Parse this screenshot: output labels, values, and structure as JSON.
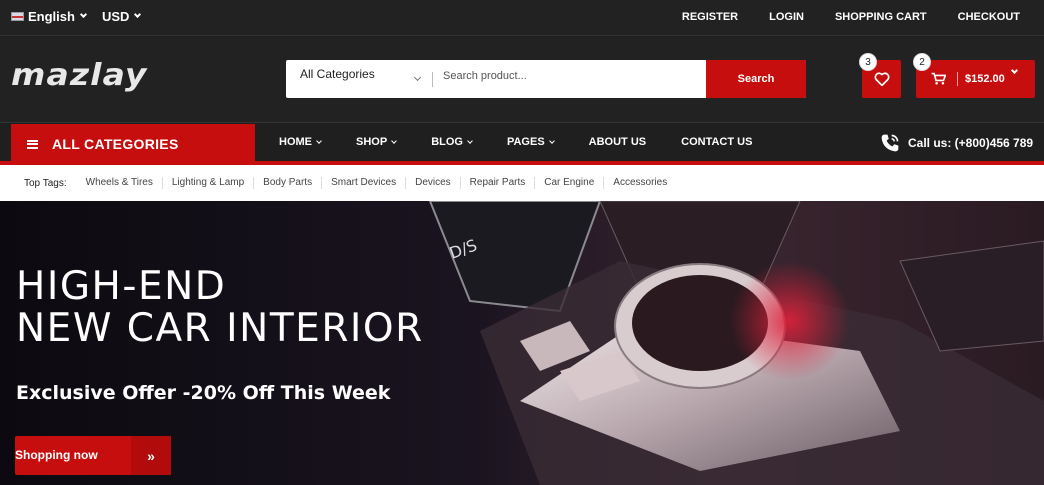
{
  "topbar": {
    "language": "English",
    "currency": "USD",
    "links": [
      "REGISTER",
      "LOGIN",
      "SHOPPING CART",
      "CHECKOUT"
    ]
  },
  "header": {
    "logo": "mazlay",
    "search_category": "All Categories",
    "search_placeholder": "Search product...",
    "search_button": "Search",
    "wishlist_count": "3",
    "cart_count": "2",
    "cart_total": "$152.00"
  },
  "nav": {
    "all_categories": "ALL CATEGORIES",
    "items": [
      "HOME",
      "SHOP",
      "BLOG",
      "PAGES",
      "ABOUT US",
      "CONTACT US"
    ],
    "call": "Call us: (+800)456 789"
  },
  "tags": {
    "label": "Top Tags:",
    "items": [
      "Wheels & Tires",
      "Lighting & Lamp",
      "Body Parts",
      "Smart Devices",
      "Devices",
      "Repair Parts",
      "Car Engine",
      "Accessories"
    ]
  },
  "hero": {
    "title_line1": "HIGH-END",
    "title_line2": "NEW CAR INTERIOR",
    "offer": "Exclusive Offer -20% Off This Week",
    "button": "Shopping now"
  },
  "colors": {
    "accent": "#c60e0e",
    "dark": "#222222"
  }
}
